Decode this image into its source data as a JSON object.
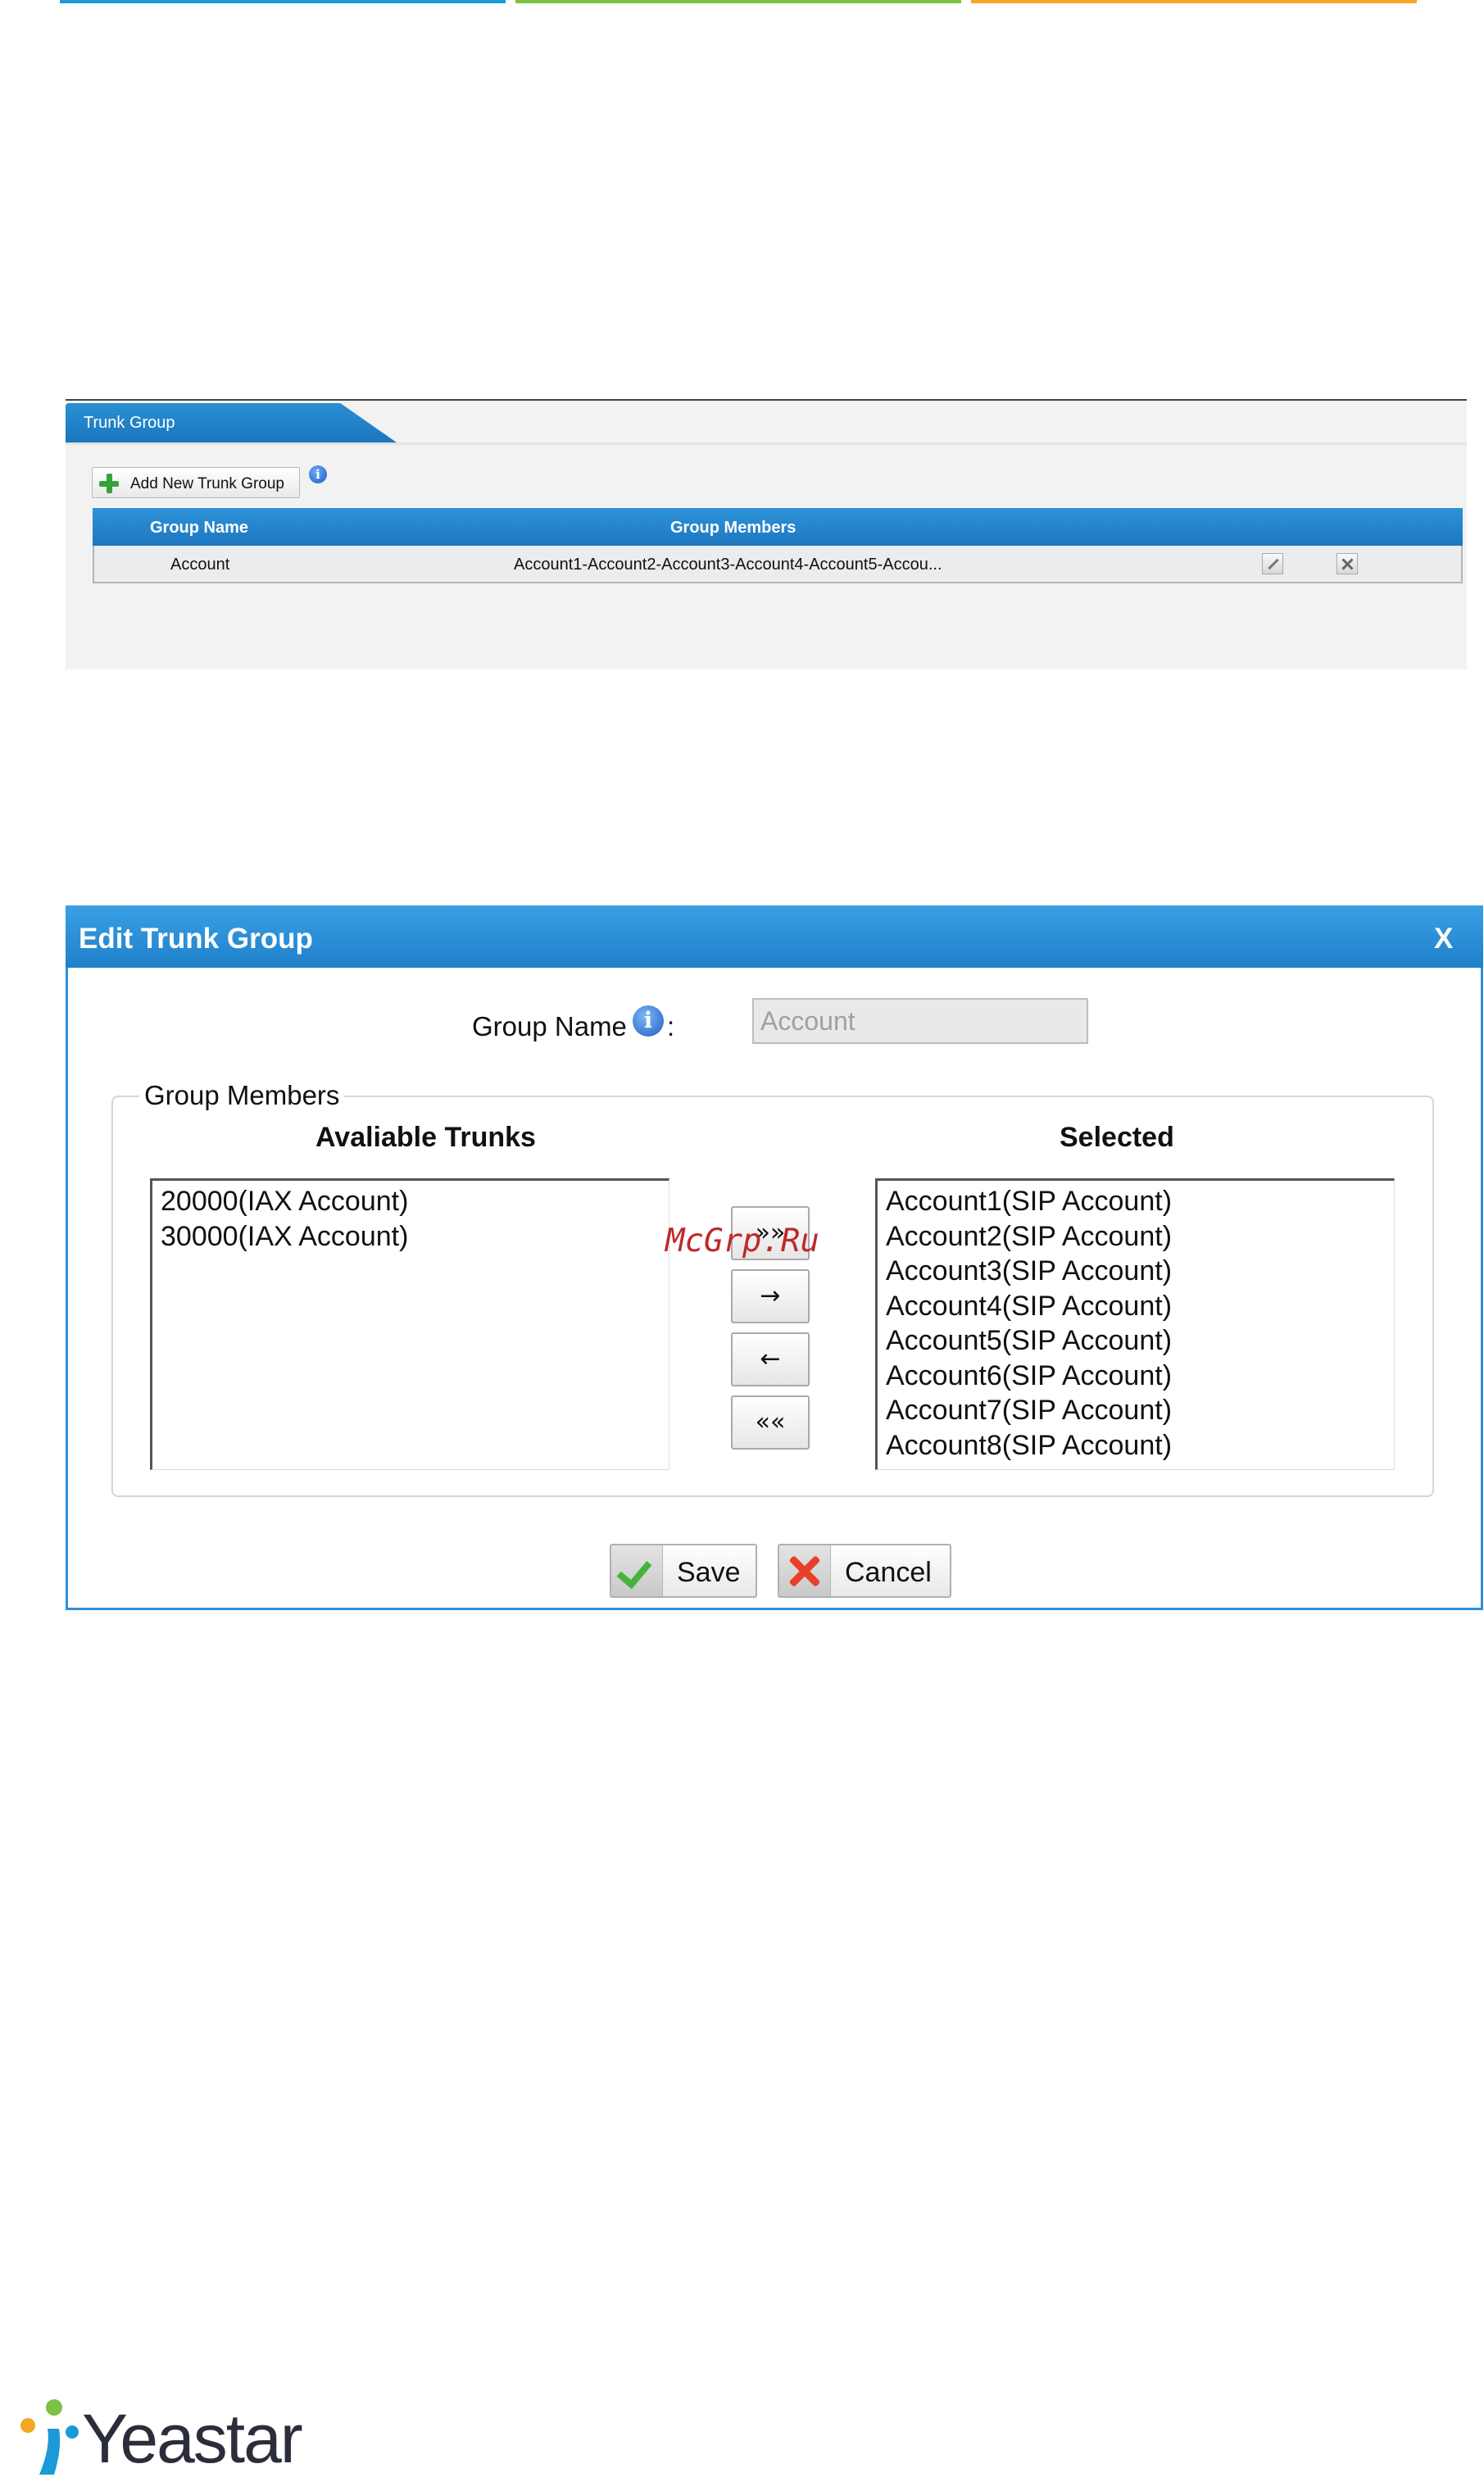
{
  "trunk_group_panel": {
    "tab_title": "Trunk Group",
    "add_button_label": "Add New Trunk Group",
    "info_glyph": "i",
    "columns": [
      "Group Name",
      "Group Members"
    ],
    "rows": [
      {
        "group_name": "Account",
        "group_members": "Account1-Account2-Account3-Account4-Account5-Accou..."
      }
    ]
  },
  "edit_dialog": {
    "title": "Edit Trunk Group",
    "close_label": "X",
    "group_name_label": "Group Name",
    "info_glyph": "i",
    "colon": ":",
    "group_name_value": "Account",
    "group_members_legend": "Group Members",
    "available_header": "Avaliable Trunks",
    "selected_header": "Selected",
    "available_trunks": [
      "20000(IAX Account)",
      "30000(IAX Account)"
    ],
    "selected_trunks": [
      "Account1(SIP Account)",
      "Account2(SIP Account)",
      "Account3(SIP Account)",
      "Account4(SIP Account)",
      "Account5(SIP Account)",
      "Account6(SIP Account)",
      "Account7(SIP Account)",
      "Account8(SIP Account)"
    ],
    "move_buttons": [
      "»»",
      "→",
      "←",
      "««"
    ],
    "save_label": "Save",
    "cancel_label": "Cancel"
  },
  "watermark": "McGrp.Ru",
  "logo_text": "Yeastar",
  "colors": {
    "accent_blue": "#1f80ca",
    "green": "#7cc242",
    "orange": "#f5a623"
  }
}
